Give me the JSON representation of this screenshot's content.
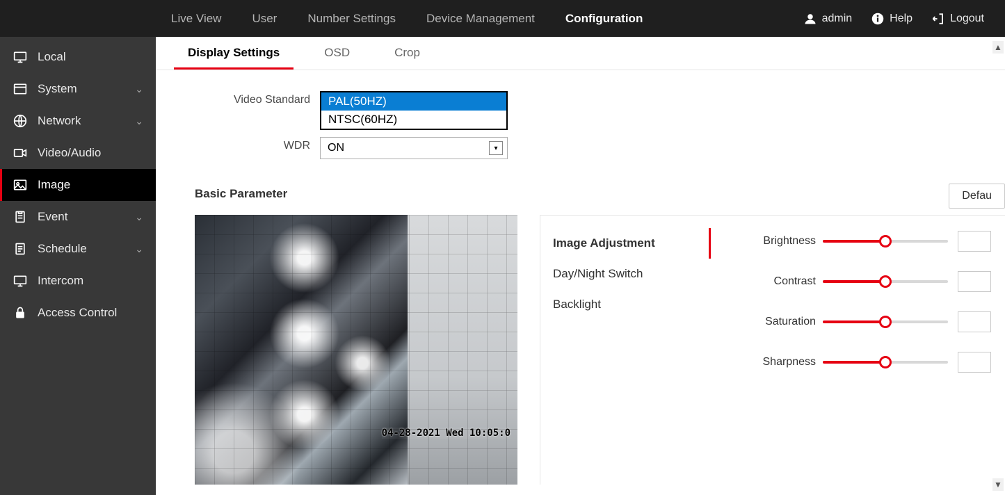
{
  "topnav": {
    "live_view": "Live View",
    "user": "User",
    "number_settings": "Number Settings",
    "device_management": "Device Management",
    "configuration": "Configuration"
  },
  "topbar": {
    "username": "admin",
    "help": "Help",
    "logout": "Logout"
  },
  "sidebar": {
    "local": "Local",
    "system": "System",
    "network": "Network",
    "video_audio": "Video/Audio",
    "image": "Image",
    "event": "Event",
    "schedule": "Schedule",
    "intercom": "Intercom",
    "access_control": "Access Control"
  },
  "subtabs": {
    "display_settings": "Display Settings",
    "osd": "OSD",
    "crop": "Crop"
  },
  "form": {
    "video_standard_label": "Video Standard",
    "video_standard_options": {
      "pal": "PAL(50HZ)",
      "ntsc": "NTSC(60HZ)"
    },
    "wdr_label": "WDR",
    "wdr_value": "ON"
  },
  "section": {
    "basic_parameter": "Basic Parameter"
  },
  "preview": {
    "timestamp": "04-28-2021 Wed 10:05:0"
  },
  "adjust_tabs": {
    "image_adjustment": "Image Adjustment",
    "day_night": "Day/Night Switch",
    "backlight": "Backlight"
  },
  "sliders": {
    "brightness": {
      "label": "Brightness",
      "percent": 50
    },
    "contrast": {
      "label": "Contrast",
      "percent": 50
    },
    "saturation": {
      "label": "Saturation",
      "percent": 50
    },
    "sharpness": {
      "label": "Sharpness",
      "percent": 50
    }
  },
  "buttons": {
    "default": "Defau"
  }
}
